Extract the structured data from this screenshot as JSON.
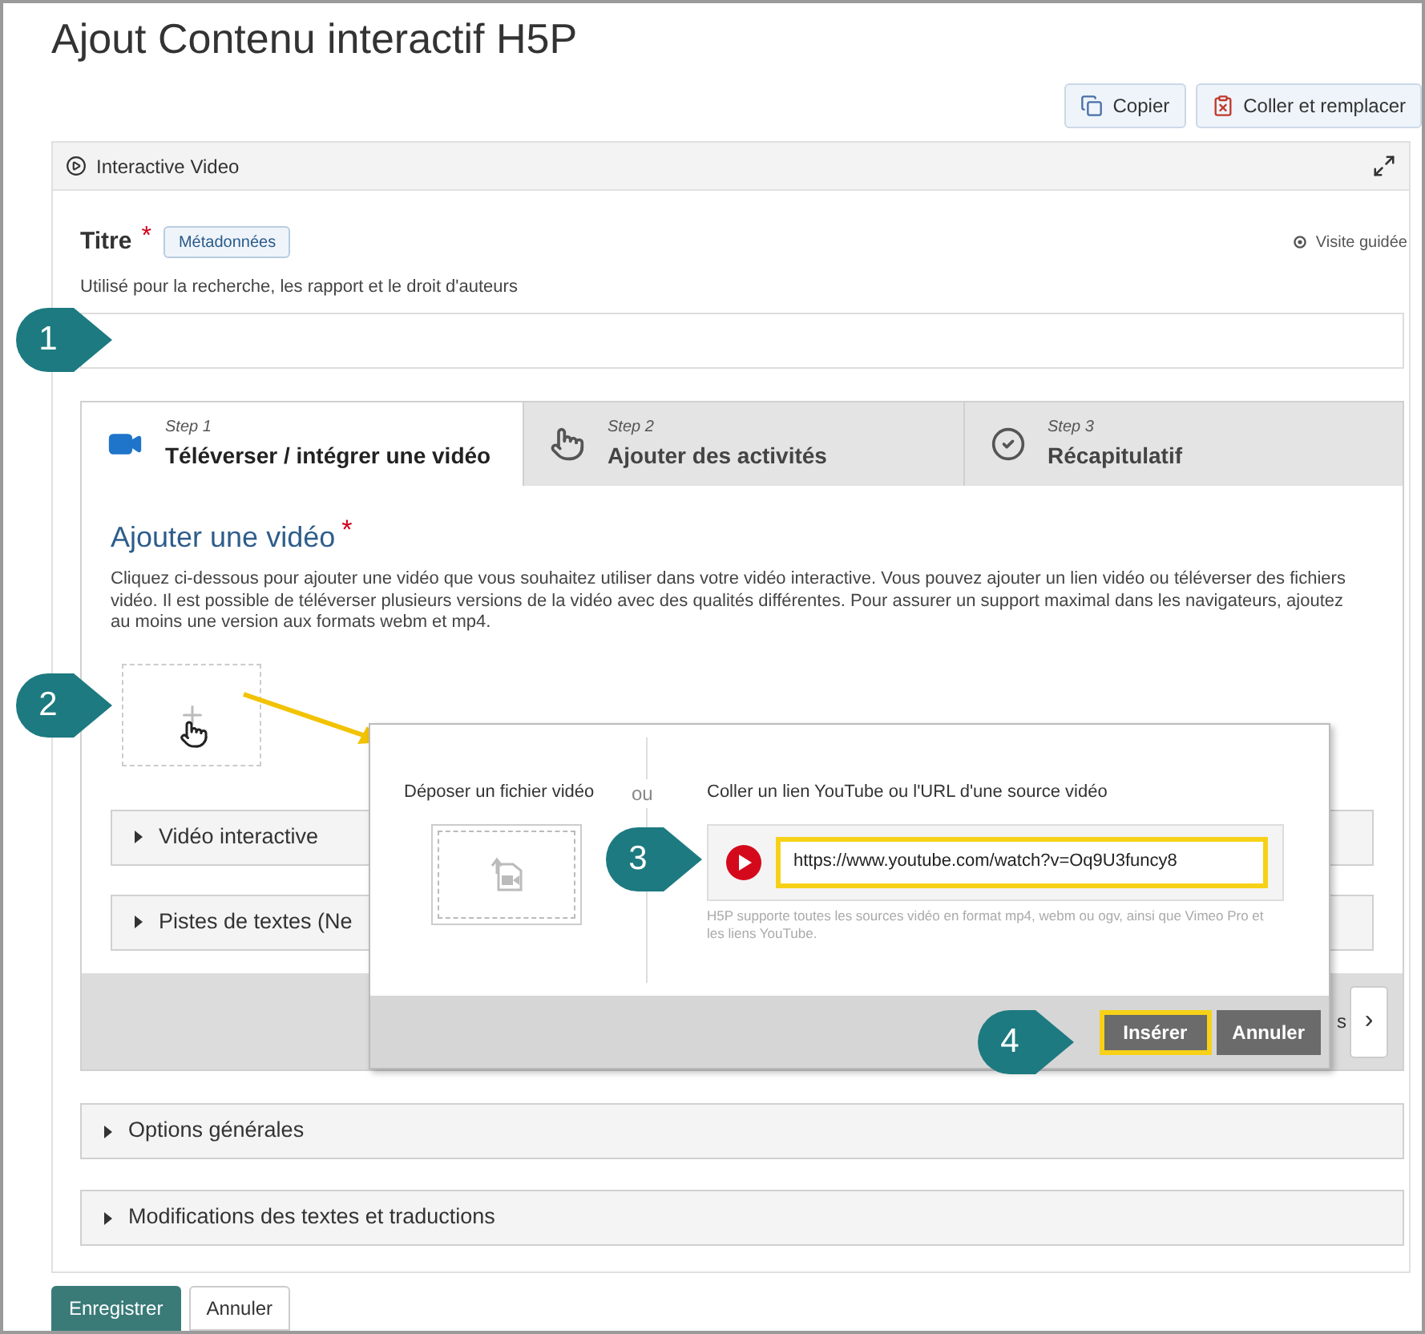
{
  "page_title": "Ajout Contenu interactif H5P",
  "toolbar": [
    {
      "label": "Copier",
      "kind": "copy"
    },
    {
      "label": "Coller et remplacer",
      "kind": "paste"
    }
  ],
  "panel": {
    "title": "Interactive Video"
  },
  "title_field": {
    "label": "Titre",
    "required_mark": "*",
    "metadata": "Métadonnées",
    "tour": "Visite guidée",
    "description": "Utilisé pour la recherche, les rapport et le droit d'auteurs"
  },
  "steps": [
    {
      "step": "Step 1",
      "label": "Téléverser / intégrer une vidéo",
      "kind": "video",
      "selected": true
    },
    {
      "step": "Step 2",
      "label": "Ajouter des activités",
      "kind": "touch",
      "selected": false
    },
    {
      "step": "Step 3",
      "label": "Récapitulatif",
      "kind": "check",
      "selected": false
    }
  ],
  "video_section": {
    "heading": "Ajouter une vidéo",
    "required_mark": "*",
    "description": "Cliquez ci-dessous pour ajouter une vidéo que vous souhaitez utiliser dans votre vidéo interactive. Vous pouvez ajouter un lien vidéo ou téléverser des fichiers vidéo. Il est possible de téléverser plusieurs versions de la vidéo avec des qualités différentes. Pour assurer un support maximal dans les navigateurs, ajoutez au moins une version aux formats webm et mp4."
  },
  "accordions": [
    {
      "label": "Vidéo interactive"
    },
    {
      "label": "Pistes de textes (Ne"
    }
  ],
  "footer_fragment": "s",
  "next_button": "›",
  "dialog": {
    "drop_label": "Déposer un fichier vidéo",
    "or": "ou",
    "url_label": "Coller un lien YouTube ou l'URL d'une source vidéo",
    "url_value": "https://www.youtube.com/watch?v=Oq9U3funcy8",
    "url_highlighted": true,
    "hint": "H5P supporte toutes les sources vidéo en format mp4, webm ou ogv, ainsi que Vimeo Pro et les liens YouTube.",
    "buttons": [
      {
        "label": "Insérer",
        "highlighted": true
      },
      {
        "label": "Annuler",
        "highlighted": false
      }
    ]
  },
  "callouts": [
    "1",
    "2",
    "3",
    "4"
  ],
  "options": [
    {
      "label": "Options générales"
    },
    {
      "label": "Modifications des textes et traductions"
    }
  ],
  "actions": [
    {
      "label": "Enregistrer",
      "kind": "primary"
    },
    {
      "label": "Annuler",
      "kind": "secondary"
    }
  ]
}
